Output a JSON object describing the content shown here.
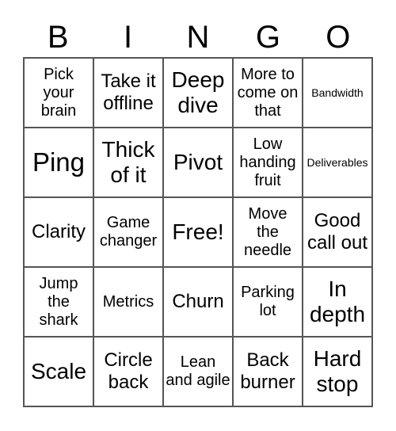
{
  "header": [
    "B",
    "I",
    "N",
    "G",
    "O"
  ],
  "cells": [
    [
      "Pick your brain",
      "Take it offline",
      "Deep dive",
      "More to come on that",
      "Bandwidth"
    ],
    [
      "Ping",
      "Thick of it",
      "Pivot",
      "Low handing fruit",
      "Deliverables"
    ],
    [
      "Clarity",
      "Game changer",
      "Free!",
      "Move the needle",
      "Good call out"
    ],
    [
      "Jump the shark",
      "Metrics",
      "Churn",
      "Parking lot",
      "In depth"
    ],
    [
      "Scale",
      "Circle back",
      "Lean and agile",
      "Back burner",
      "Hard stop"
    ]
  ]
}
